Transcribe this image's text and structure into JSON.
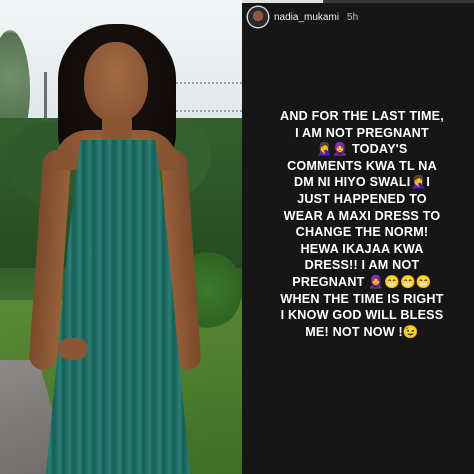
{
  "story": {
    "username": "nadia_mukami",
    "time": "5h",
    "progress_fraction": 0.35,
    "caption_lines": [
      "AND FOR THE LAST TIME,",
      "I AM NOT PREGNANT",
      "🤦‍♀️🧕 TODAY'S",
      "COMMENTS KWA TL NA",
      "DM NI HIYO SWALI🤦‍♀️I",
      "JUST HAPPENED TO",
      "WEAR A MAXI DRESS TO",
      "CHANGE THE NORM!",
      "HEWA IKAJAA KWA",
      "DRESS!! I AM NOT",
      "PREGNANT 🧕😁😁😁",
      "WHEN THE TIME IS RIGHT",
      "I KNOW GOD WILL BLESS",
      "ME! NOT NOW !😉"
    ]
  },
  "colors": {
    "story_background": "#161616",
    "text": "#ffffff",
    "dress": "#1f6b64"
  },
  "icons": {
    "avatar": "profile-avatar"
  }
}
